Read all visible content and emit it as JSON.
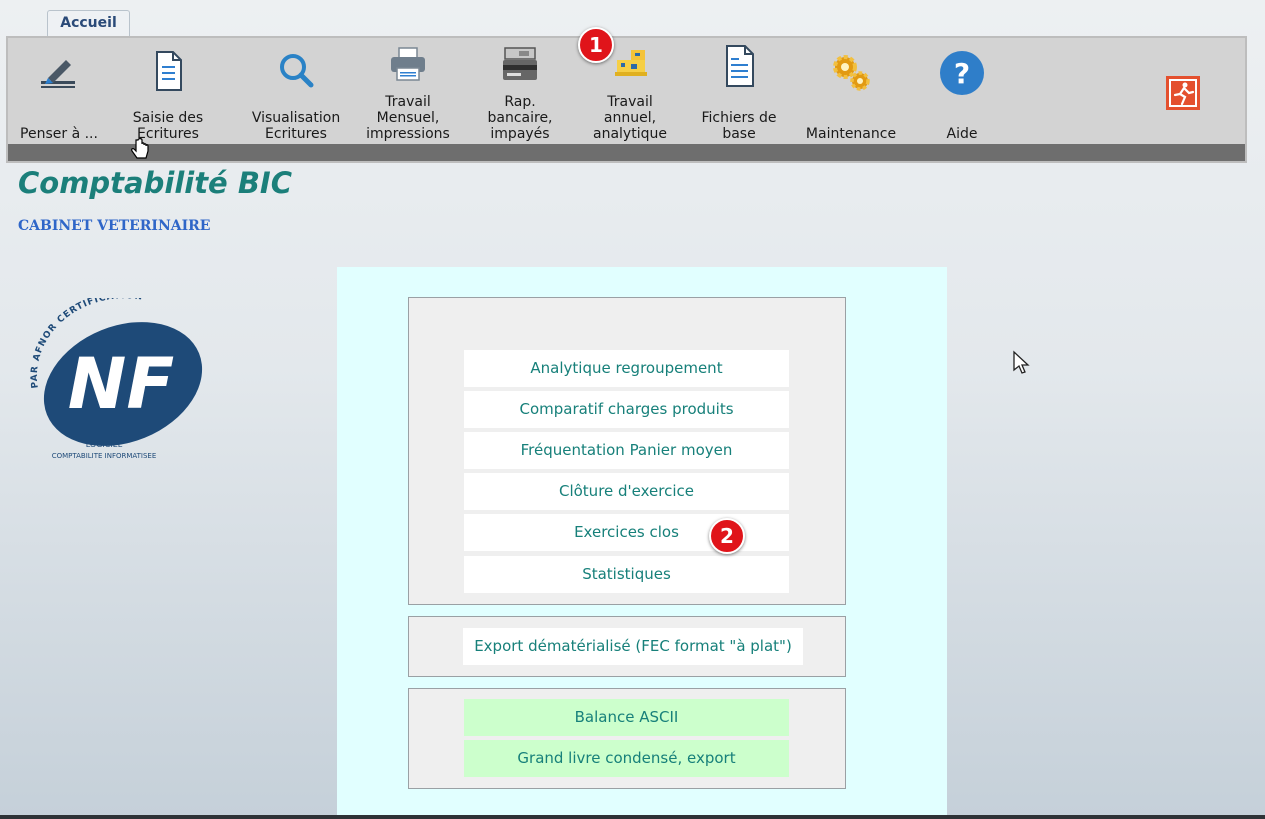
{
  "tab": {
    "label": "Accueil"
  },
  "ribbon": {
    "buttons": [
      {
        "label": "Penser à ...",
        "icon": "pen-icon"
      },
      {
        "label": "Saisie des\nEcritures",
        "icon": "document-icon"
      },
      {
        "label": "Visualisation\nEcritures",
        "icon": "search-icon"
      },
      {
        "label": "Travail\nMensuel,\nimpressions",
        "icon": "printer-icon"
      },
      {
        "label": "Rap.\nbancaire,\nimpayés",
        "icon": "bank-card-icon"
      },
      {
        "label": "Travail\nannuel,\nanalytique",
        "icon": "forklift-icon"
      },
      {
        "label": "Fichiers de\nbase",
        "icon": "file-list-icon"
      },
      {
        "label": "Maintenance",
        "icon": "gears-icon"
      },
      {
        "label": "Aide",
        "icon": "help-icon"
      }
    ],
    "exit_icon": "exit-icon"
  },
  "badges": [
    "1",
    "2"
  ],
  "header": {
    "title": "Comptabilité BIC",
    "subtitle": "CABINET VETERINAIRE"
  },
  "logo": {
    "arc_text": "PAR AFNOR CERTIFICATION",
    "main": "NF",
    "line1": "LOGICIEL",
    "line2": "COMPTABILITE INFORMATISEE"
  },
  "menu": {
    "group1": [
      "Analytique regroupement",
      "Comparatif  charges produits",
      "Fréquentation Panier moyen",
      "Clôture d'exercice",
      "Exercices clos",
      "Statistiques"
    ],
    "group2": [
      "Export dématérialisé (FEC format \"à plat\")"
    ],
    "group3": [
      "Balance ASCII",
      "Grand livre condensé, export"
    ]
  },
  "colors": {
    "title": "#1b7f7a",
    "subtitle": "#2f66c8",
    "panel": "#e1ffff",
    "green_button": "#ccffcc",
    "badge": "#e0141a"
  }
}
